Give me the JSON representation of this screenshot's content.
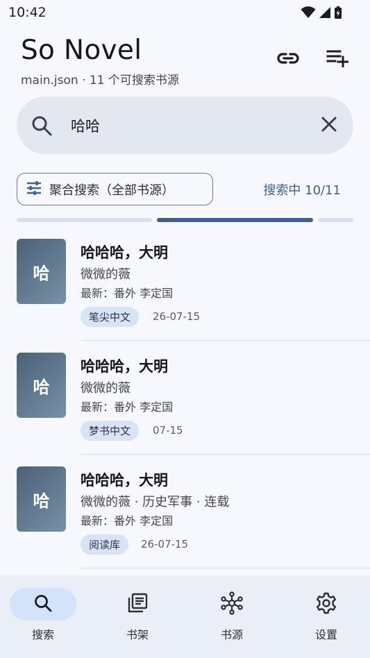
{
  "status_bar": {
    "time": "10:42"
  },
  "header": {
    "title": "So Novel",
    "subtitle": "main.json · 11 个可搜索书源",
    "link_icon": "link-icon",
    "add_icon": "playlist-add-icon"
  },
  "search": {
    "query": "哈哈",
    "search_icon": "search-icon",
    "clear_icon": "close-icon"
  },
  "filter": {
    "label": "聚合搜索（全部书源）",
    "icon": "tune-icon",
    "status": "搜索中 10/11"
  },
  "results": [
    {
      "cover_text": "哈",
      "title": "哈哈哈，大明",
      "author": "微微的薇",
      "latest": "最新：番外 李定国",
      "source": "笔尖中文",
      "date": "26-07-15"
    },
    {
      "cover_text": "哈",
      "title": "哈哈哈，大明",
      "author": "微微的薇",
      "latest": "最新：番外 李定国",
      "source": "梦书中文",
      "date": "07-15"
    },
    {
      "cover_text": "哈",
      "title": "哈哈哈，大明",
      "author": "微微的薇 · 历史军事 · 连载",
      "latest": "最新：番外 李定国",
      "source": "阅读库",
      "date": "26-07-15"
    }
  ],
  "nav": [
    {
      "label": "搜索",
      "icon": "search-icon",
      "active": true
    },
    {
      "label": "书架",
      "icon": "library-books-icon",
      "active": false
    },
    {
      "label": "书源",
      "icon": "hub-icon",
      "active": false
    },
    {
      "label": "设置",
      "icon": "settings-gear-icon",
      "active": false
    }
  ],
  "colors": {
    "accent": "#3e628f",
    "background": "#f6f8fd",
    "search_bar": "#e3e7f0",
    "badge": "#d8e3f5",
    "nav_active": "#d3e3fb"
  }
}
